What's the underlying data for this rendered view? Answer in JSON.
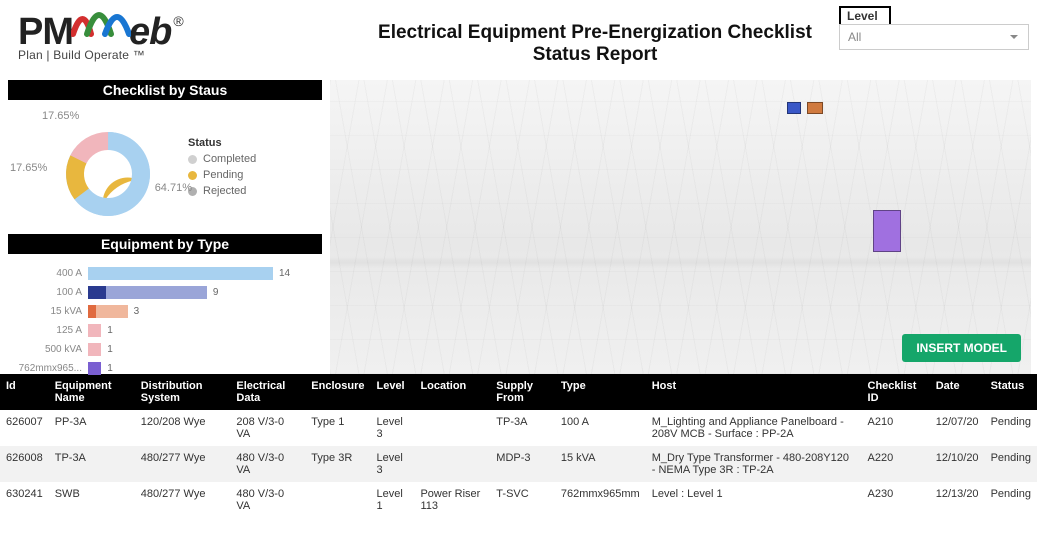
{
  "header": {
    "tagline": "Plan | Build Operate ™",
    "title_line1": "Electrical Equipment Pre-Energization Checklist",
    "title_line2": "Status Report"
  },
  "filter": {
    "label": "Level",
    "value": "All"
  },
  "sections": {
    "status_title": "Checklist by Staus",
    "type_title": "Equipment by Type"
  },
  "legend": {
    "title": "Status",
    "items": [
      {
        "label": "Completed",
        "color": "#d0d0d0"
      },
      {
        "label": "Pending",
        "color": "#e8b73e"
      },
      {
        "label": "Rejected",
        "color": "#b0b0b0"
      }
    ]
  },
  "donut_labels": {
    "main": "64.71%",
    "left": "17.65%",
    "top": "17.65%"
  },
  "viewer": {
    "button": "INSERT MODEL"
  },
  "table": {
    "headers": [
      "Id",
      "Equipment Name",
      "Distribution System",
      "Electrical Data",
      "Enclosure",
      "Level",
      "Location",
      "Supply From",
      "Type",
      "Host",
      "Checklist ID",
      "Date",
      "Status"
    ],
    "rows": [
      {
        "id": "626007",
        "name": "PP-3A",
        "dist": "120/208 Wye",
        "elec": "208 V/3-0 VA",
        "enc": "Type 1",
        "level": "Level 3",
        "loc": "",
        "supply": "TP-3A",
        "type": "100 A",
        "host": "M_Lighting and Appliance Panelboard - 208V MCB - Surface : PP-2A",
        "cid": "A210",
        "date": "12/07/20",
        "status": "Pending"
      },
      {
        "id": "626008",
        "name": "TP-3A",
        "dist": "480/277 Wye",
        "elec": "480 V/3-0 VA",
        "enc": "Type 3R",
        "level": "Level 3",
        "loc": "",
        "supply": "MDP-3",
        "type": "15 kVA",
        "host": "M_Dry Type Transformer - 480-208Y120 - NEMA Type 3R : TP-2A",
        "cid": "A220",
        "date": "12/10/20",
        "status": "Pending"
      },
      {
        "id": "630241",
        "name": "SWB",
        "dist": "480/277 Wye",
        "elec": "480 V/3-0 VA",
        "enc": "",
        "level": "Level 1",
        "loc": "Power Riser 113",
        "supply": "T-SVC",
        "type": "762mmx965mm",
        "host": "Level : Level 1",
        "cid": "A230",
        "date": "12/13/20",
        "status": "Pending"
      }
    ]
  },
  "chart_data": [
    {
      "type": "pie",
      "title": "Checklist by Staus",
      "series": [
        {
          "name": "Completed",
          "value": 64.71,
          "color": "#a8d1f0"
        },
        {
          "name": "Pending",
          "value": 17.65,
          "color": "#e8b73e"
        },
        {
          "name": "Rejected",
          "value": 17.65,
          "color": "#f1b6bc"
        }
      ]
    },
    {
      "type": "bar",
      "title": "Equipment by Type",
      "categories": [
        "400 A",
        "100 A",
        "15 kVA",
        "125 A",
        "500 kVA",
        "762mmx965..."
      ],
      "values": [
        14,
        9,
        3,
        1,
        1,
        1
      ],
      "xlabel": "",
      "ylabel": "",
      "ylim": [
        0,
        14
      ],
      "colors": {
        "400 A": [
          "#a8d1f0"
        ],
        "100 A": [
          "#2a3a8f",
          "#9aa5d8"
        ],
        "15 kVA": [
          "#e06a3f",
          "#f0b79c"
        ],
        "125 A": [
          "#f1b6bc"
        ],
        "500 kVA": [
          "#f1b6bc"
        ],
        "762mmx965...": [
          "#7a5fd1"
        ]
      }
    }
  ]
}
